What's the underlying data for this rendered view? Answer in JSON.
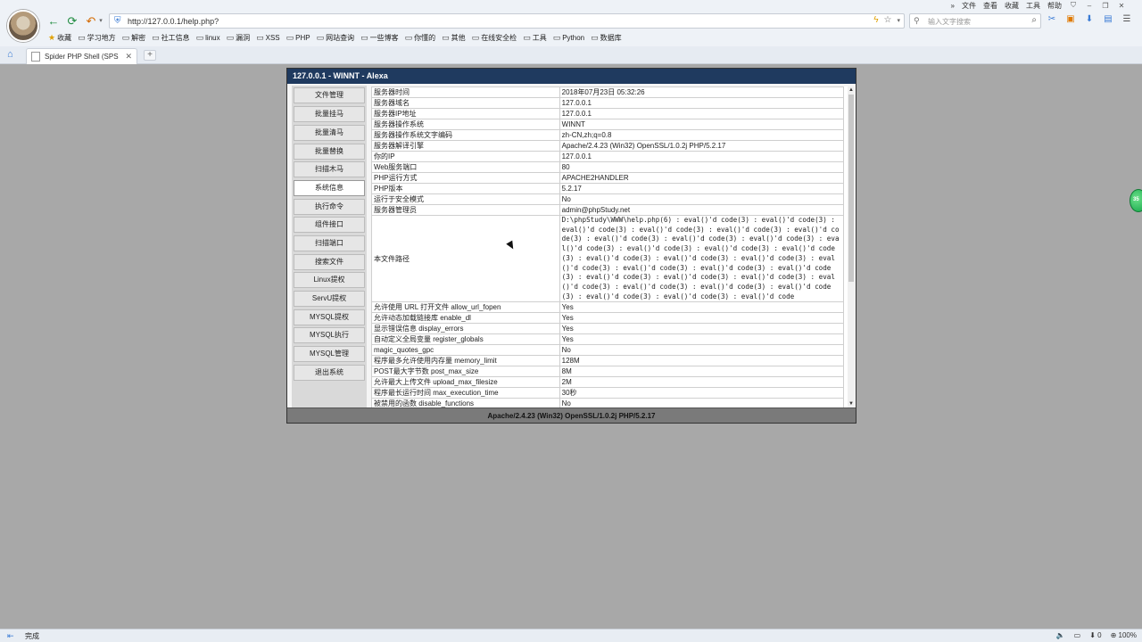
{
  "browser": {
    "menu": [
      "文件",
      "查看",
      "收藏",
      "工具",
      "帮助"
    ],
    "url": "http://127.0.0.1/help.php?",
    "search_placeholder": "输入文字搜索",
    "bookmarks": [
      "收藏",
      "学习地方",
      "解密",
      "社工信息",
      "linux",
      "漏洞",
      "XSS",
      "PHP",
      "网站查询",
      "一些博客",
      "你懂的",
      "其他",
      "在线安全检",
      "工具",
      "Python",
      "数据库"
    ],
    "tab_title": "Spider PHP Shell (SPS",
    "status_text": "完成",
    "status_zero": "0",
    "zoom": "100%"
  },
  "panel": {
    "title": "127.0.0.1 - WINNT - Alexa",
    "footer": "Apache/2.4.23 (Win32) OpenSSL/1.0.2j PHP/5.2.17"
  },
  "sidebar": {
    "items": [
      "文件管理",
      "批量挂马",
      "批量清马",
      "批量替换",
      "扫描木马",
      "系统信息",
      "执行命令",
      "组件接口",
      "扫描端口",
      "搜索文件",
      "Linux提权",
      "ServU提权",
      "MYSQL提权",
      "MYSQL执行",
      "MYSQL管理",
      "退出系统"
    ],
    "active_index": 5
  },
  "info": {
    "rows": [
      {
        "key": "服务器时间",
        "value": "2018年07月23日 05:32:26"
      },
      {
        "key": "服务器域名",
        "value": "127.0.0.1"
      },
      {
        "key": "服务器IP地址",
        "value": "127.0.0.1"
      },
      {
        "key": "服务器操作系统",
        "value": "WINNT"
      },
      {
        "key": "服务器操作系统文字编码",
        "value": "zh-CN,zh;q=0.8"
      },
      {
        "key": "服务器解译引擎",
        "value": "Apache/2.4.23 (Win32) OpenSSL/1.0.2j PHP/5.2.17"
      },
      {
        "key": "你的IP",
        "value": "127.0.0.1"
      },
      {
        "key": "Web服务端口",
        "value": "80"
      },
      {
        "key": "PHP运行方式",
        "value": "APACHE2HANDLER"
      },
      {
        "key": "PHP版本",
        "value": "5.2.17"
      },
      {
        "key": "运行于安全模式",
        "value": "No"
      },
      {
        "key": "服务器管理员",
        "value": "admin@phpStudy.net"
      },
      {
        "key": "本文件路径",
        "value": "D:\\phpStudy\\WWW\\help.php(6) : eval()'d code(3) : eval()'d code(3) : eval()'d code(3) : eval()'d code(3) : eval()'d code(3) : eval()'d code(3) : eval()'d code(3) : eval()'d code(3) : eval()'d code(3) : eval()'d code(3) : eval()'d code(3) : eval()'d code(3) : eval()'d code(3) : eval()'d code(3) : eval()'d code(3) : eval()'d code(3) : eval()'d code(3) : eval()'d code(3) : eval()'d code(3) : eval()'d code(3) : eval()'d code(3) : eval()'d code(3) : eval()'d code(3) : eval()'d code(3) : eval()'d code(3) : eval()'d code(3) : eval()'d code(3) : eval()'d code(3) : eval()'d code(3) : eval()'d code",
        "mono": true
      },
      {
        "key": "允许使用 URL 打开文件 allow_url_fopen",
        "value": "Yes"
      },
      {
        "key": "允许动态加载链接库 enable_dl",
        "value": "Yes"
      },
      {
        "key": "显示错误信息 display_errors",
        "value": "Yes"
      },
      {
        "key": "自动定义全局变量 register_globals",
        "value": "Yes"
      },
      {
        "key": "magic_quotes_gpc",
        "value": "No"
      },
      {
        "key": "程序最多允许使用内存量 memory_limit",
        "value": "128M"
      },
      {
        "key": "POST最大字节数 post_max_size",
        "value": "8M"
      },
      {
        "key": "允许最大上传文件 upload_max_filesize",
        "value": "2M"
      },
      {
        "key": "程序最长运行时间 max_execution_time",
        "value": "30秒"
      },
      {
        "key": "被禁用的函数 disable_functions",
        "value": "No"
      }
    ]
  },
  "floating_ball_text": "35"
}
